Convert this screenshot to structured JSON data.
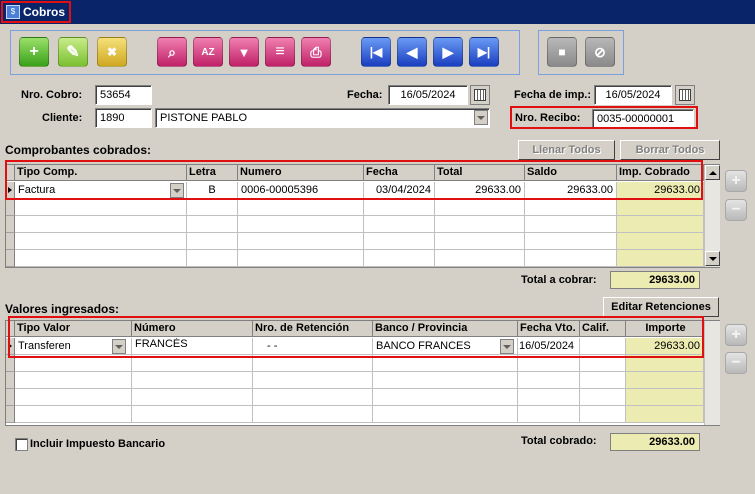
{
  "window": {
    "title": "Cobros",
    "icon": "cobros-app-icon"
  },
  "toolbar": {
    "buttons": [
      {
        "name": "add-icon",
        "glyph": "+"
      },
      {
        "name": "edit-icon",
        "glyph": "✎"
      },
      {
        "name": "delete-icon",
        "glyph": "✖"
      },
      {
        "name": "search-icon",
        "glyph": "🔍"
      },
      {
        "name": "sort-az-icon",
        "glyph": "AZ"
      },
      {
        "name": "filter-icon",
        "glyph": "▼"
      },
      {
        "name": "report-icon",
        "glyph": "≡"
      },
      {
        "name": "print-icon",
        "glyph": "⎙"
      },
      {
        "name": "first-record-icon",
        "glyph": "|◀"
      },
      {
        "name": "previous-record-icon",
        "glyph": "◀"
      },
      {
        "name": "next-record-icon",
        "glyph": "▶"
      },
      {
        "name": "last-record-icon",
        "glyph": "▶|"
      },
      {
        "name": "save-icon",
        "glyph": "■"
      },
      {
        "name": "cancel-icon",
        "glyph": "⊘"
      }
    ]
  },
  "form": {
    "nro_cobro_label": "Nro. Cobro:",
    "nro_cobro": "53654",
    "fecha_label": "Fecha:",
    "fecha": "16/05/2024",
    "fecha_imp_label": "Fecha de imp.:",
    "fecha_imp": "16/05/2024",
    "cliente_label": "Cliente:",
    "cliente_codigo": "1890",
    "cliente_nombre": "PISTONE PABLO",
    "nro_recibo_label": "Nro. Recibo:",
    "nro_recibo": "0035-00000001"
  },
  "comprobantes": {
    "title": "Comprobantes cobrados:",
    "llenar_label": "Llenar Todos",
    "borrar_label": "Borrar Todos",
    "columns": [
      "Tipo Comp.",
      "Letra",
      "Numero",
      "Fecha",
      "Total",
      "Saldo",
      "Imp. Cobrado"
    ],
    "rows": [
      {
        "tipo": "Factura",
        "letra": "B",
        "numero": "0006-00005396",
        "fecha": "03/04/2024",
        "total": "29633.00",
        "saldo": "29633.00",
        "imp_cobrado": "29633.00"
      }
    ],
    "total_label": "Total a cobrar:",
    "total": "29633.00"
  },
  "valores": {
    "title": "Valores ingresados:",
    "editar_label": "Editar Retenciones",
    "columns": [
      "Tipo Valor",
      "Número",
      "Nro. de Retención",
      "Banco / Provincia",
      "Fecha Vto.",
      "Calif.",
      "Importe"
    ],
    "rows": [
      {
        "tipo": "Transferen",
        "numero": "FRANCÉS",
        "retencion": "-   -",
        "banco": "BANCO FRANCES",
        "fecha_vto": "16/05/2024",
        "calif": "",
        "importe": "29633.00"
      }
    ],
    "total_label": "Total cobrado:",
    "total": "29633.00",
    "incluir_label": "Incluir Impuesto Bancario"
  }
}
